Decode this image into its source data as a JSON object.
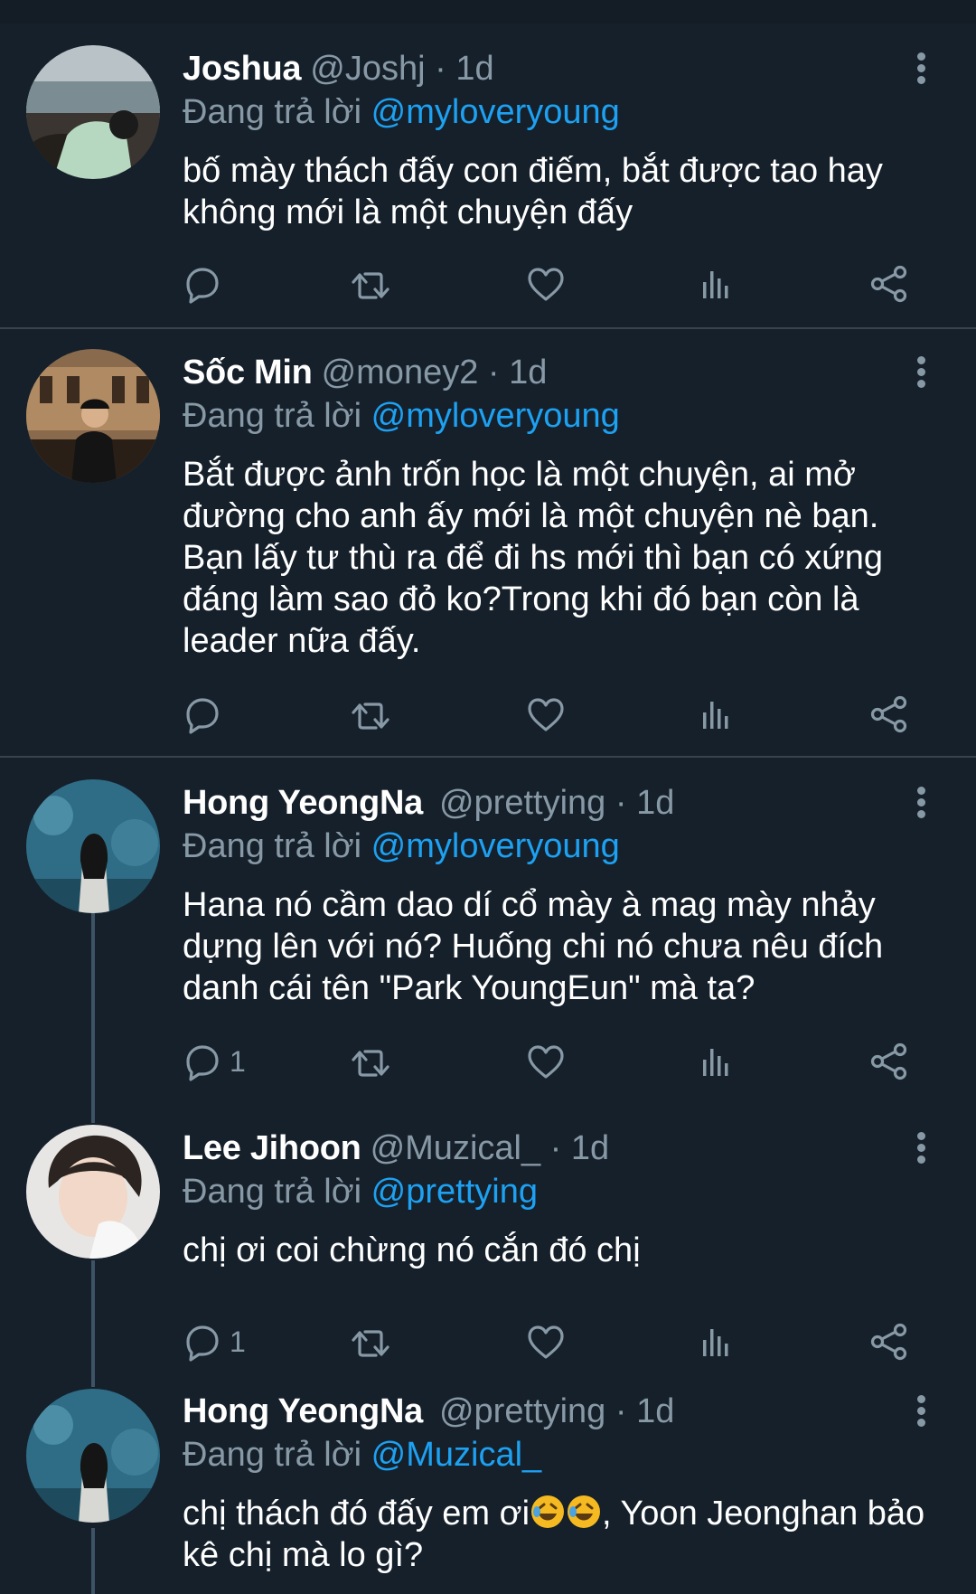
{
  "tweets": [
    {
      "name": "Joshua",
      "handle": "@Joshj",
      "dot": "·",
      "time": "1d",
      "replying_label": "Đang trả lời",
      "replying_to": "@myloveryoung",
      "text": "bố mày thách đấy con điếm, bắt được tao hay không mới là một chuyện đấy",
      "reply_count": ""
    },
    {
      "name": "Sốc Min",
      "handle": "@money2",
      "dot": "·",
      "time": "1d",
      "replying_label": "Đang trả lời",
      "replying_to": "@myloveryoung",
      "text": "Bắt được ảnh trốn học là một chuyện, ai mở đường cho anh ấy mới là một chuyện nè bạn. Bạn lấy tư thù ra để đi hs mới thì bạn có xứng đáng làm sao đỏ ko?Trong khi đó bạn còn là leader nữa đấy.",
      "reply_count": ""
    },
    {
      "name": "Hong YeongNa",
      "handle": "@prettying",
      "dot": "·",
      "time": "1d",
      "replying_label": "Đang trả lời",
      "replying_to": "@myloveryoung",
      "text": "Hana nó cầm dao dí cổ mày à mag mày nhảy dựng lên với nó? Huống chi nó chưa nêu đích danh cái tên \"Park YoungEun\" mà ta?",
      "reply_count": "1"
    },
    {
      "name": "Lee Jihoon",
      "handle": "@Muzical_",
      "dot": "·",
      "time": "1d",
      "replying_label": "Đang trả lời",
      "replying_to": "@prettying",
      "text": "chị ơi coi chừng nó cắn đó chị",
      "reply_count": "1"
    },
    {
      "name": "Hong YeongNa",
      "handle": "@prettying",
      "dot": "·",
      "time": "1d",
      "replying_label": "Đang trả lời",
      "replying_to": "@Muzical_",
      "text_before": "chị thách đó đấy em ơi",
      "text_after": ", Yoon Jeonghan bảo kê chị mà lo gì?",
      "emoji": "rolling-on-floor-laughing",
      "reply_count": ""
    }
  ],
  "icons": {
    "reply": "reply-icon",
    "retweet": "retweet-icon",
    "like": "like-icon",
    "views": "views-icon",
    "share": "share-icon",
    "more": "more-icon"
  },
  "colors": {
    "background": "#15202b",
    "text": "#ffffff",
    "secondary": "#8899a6",
    "accent": "#1da1f2",
    "divider": "#38444d",
    "thread_line": "#3d5466"
  }
}
